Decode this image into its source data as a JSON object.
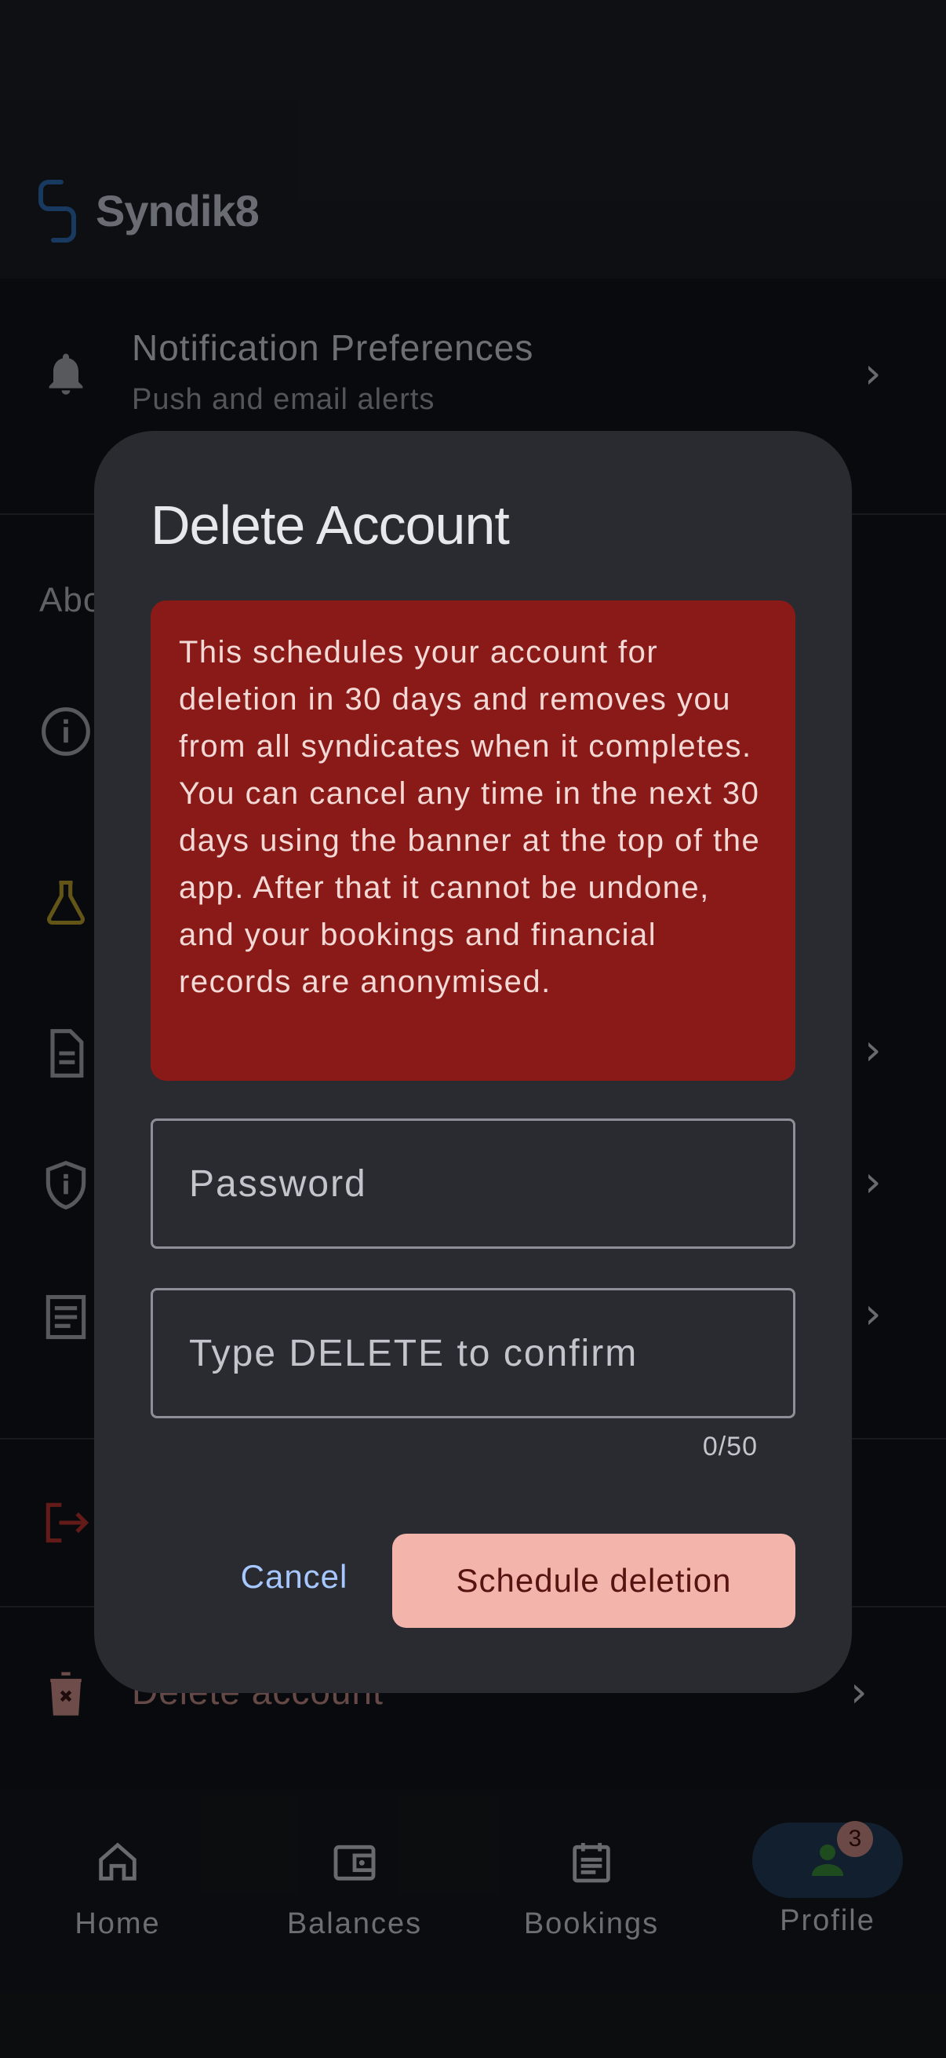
{
  "app": {
    "name": "Syndik8"
  },
  "background": {
    "notification_row": {
      "title": "Notification Preferences",
      "subtitle": "Push and email alerts"
    },
    "about_section_partial": "Abo",
    "delete_row_label": "Delete account"
  },
  "dialog": {
    "title": "Delete Account",
    "warning": "This schedules your account for deletion in 30 days and removes you from all syndicates when it completes. You can cancel any time in the next 30 days using the banner at the top of the app. After that it cannot be undone, and your bookings and financial records are anonymised.",
    "password": {
      "placeholder": "Password",
      "value": ""
    },
    "confirm": {
      "placeholder": "Type DELETE to confirm",
      "value": "",
      "counter": "0/50"
    },
    "cancel_label": "Cancel",
    "confirm_label": "Schedule deletion"
  },
  "bottom_nav": {
    "items": [
      {
        "label": "Home",
        "icon": "home-icon"
      },
      {
        "label": "Balances",
        "icon": "wallet-icon"
      },
      {
        "label": "Bookings",
        "icon": "calendar-icon"
      },
      {
        "label": "Profile",
        "icon": "person-icon",
        "badge": "3",
        "active": true
      }
    ]
  },
  "colors": {
    "warning_bg": "#8a1a18",
    "primary_button": "#f3b4ab",
    "accent_link": "#a7c8ff",
    "nav_active_pill": "#203a55",
    "profile_icon": "#3a8a3a",
    "logout_icon": "#b3322e",
    "flask_icon": "#b59a2a"
  }
}
